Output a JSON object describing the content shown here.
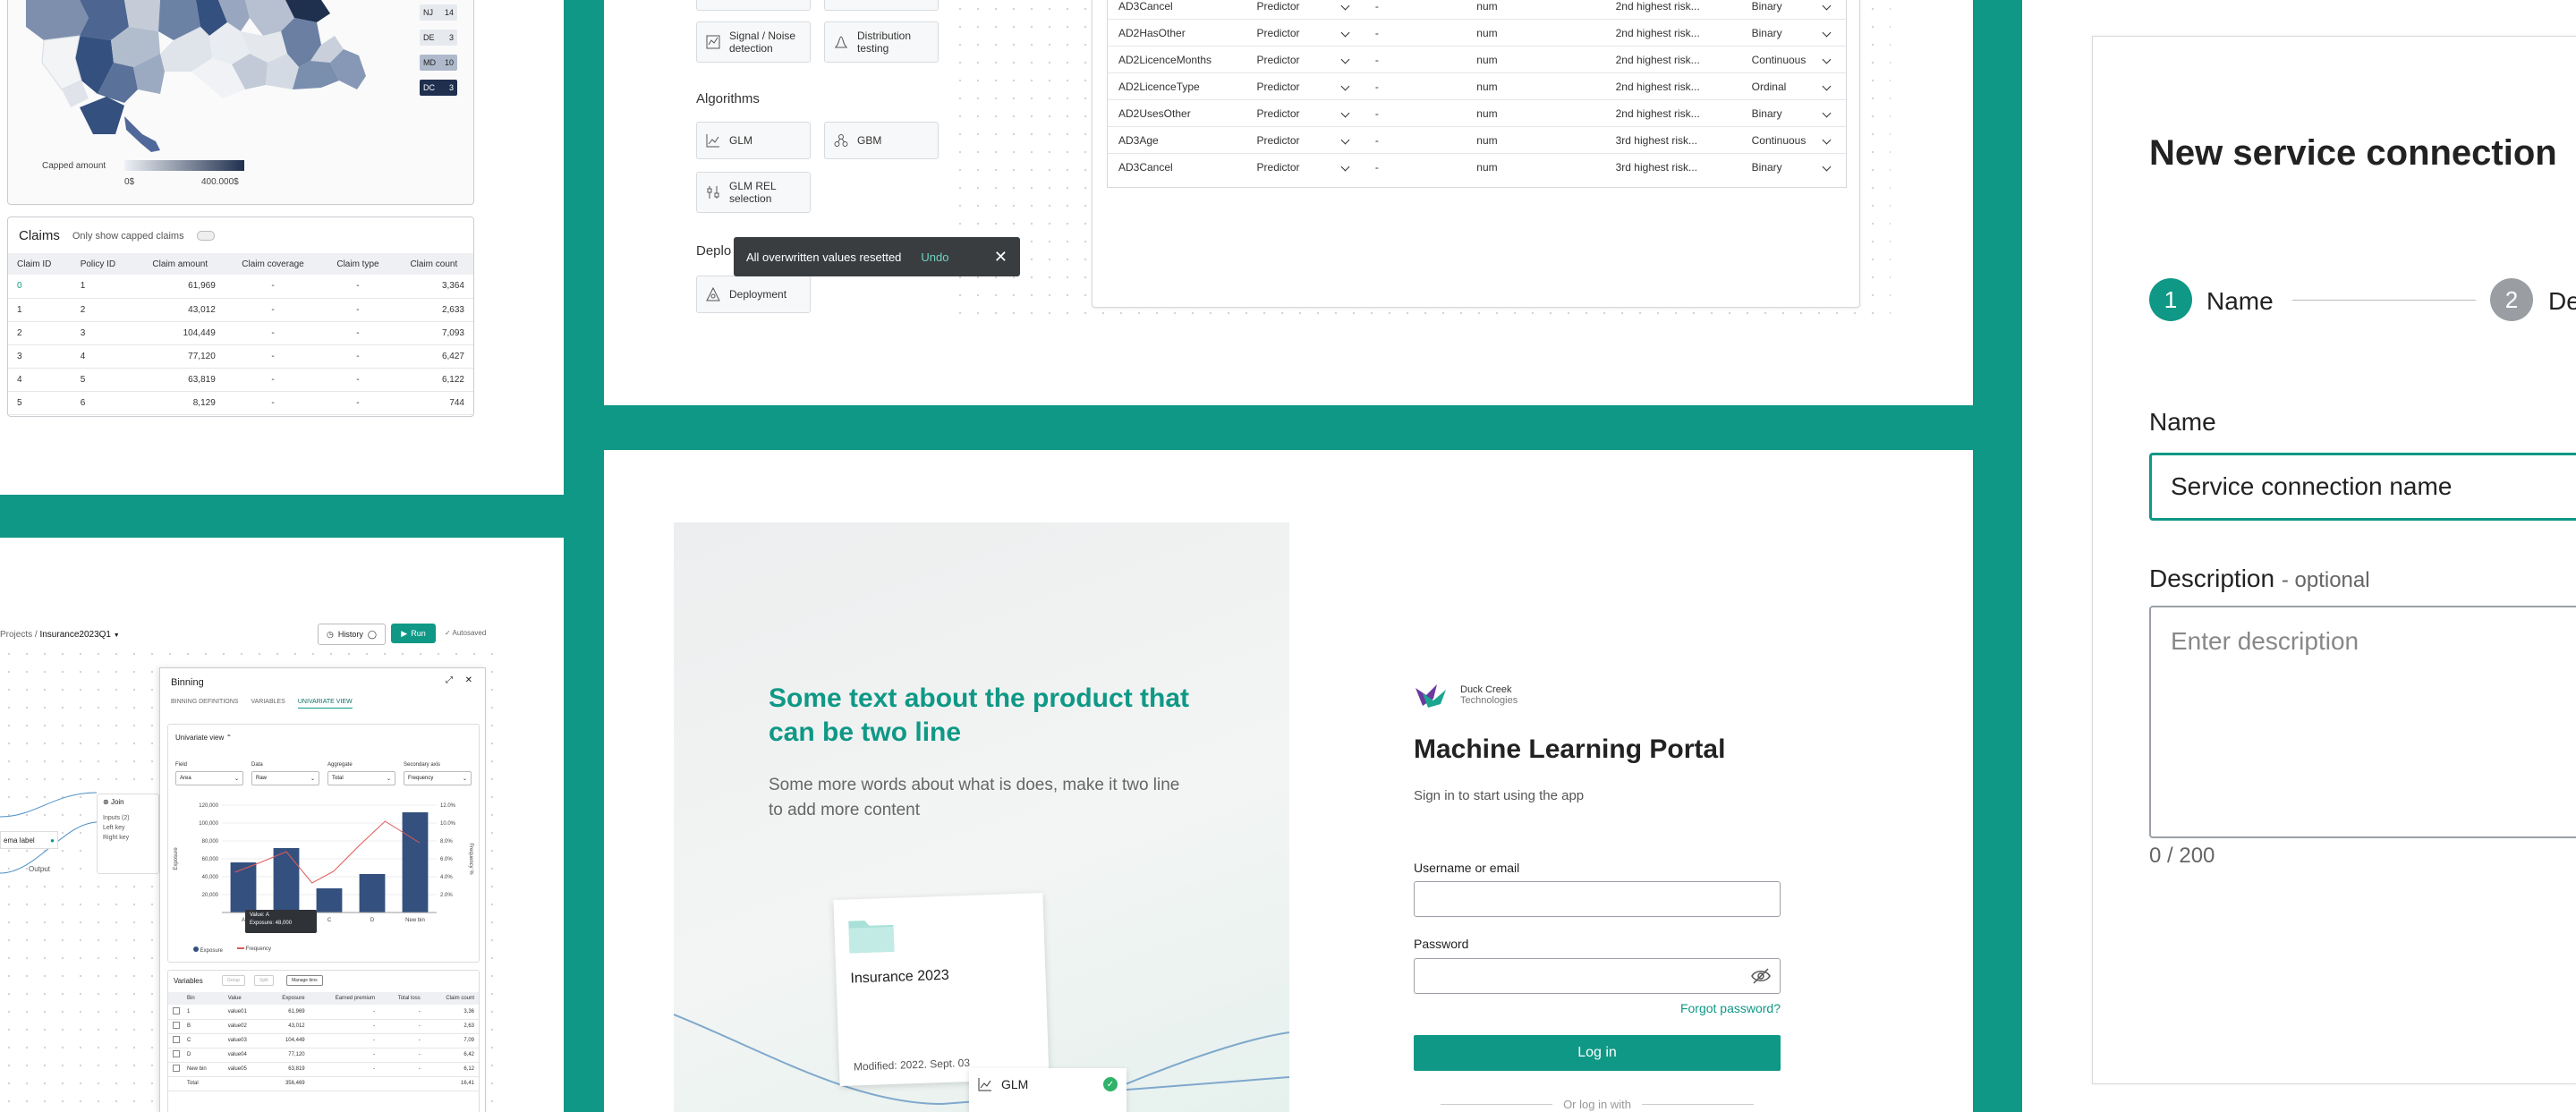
{
  "colors": {
    "accent": "#0f9886",
    "navy": "#1f2f4e",
    "map_dark": "#34507e"
  },
  "map": {
    "states": [
      {
        "code": "NJ",
        "value": "14"
      },
      {
        "code": "DE",
        "value": "3"
      },
      {
        "code": "MD",
        "value": "10"
      },
      {
        "code": "DC",
        "value": "3"
      }
    ],
    "legend_label": "Capped amount",
    "legend_min": "0$",
    "legend_max": "400.000$"
  },
  "claims": {
    "title": "Claims",
    "toggle_label": "Only show capped claims",
    "columns": [
      "Claim ID",
      "Policy ID",
      "Claim amount",
      "Claim coverage",
      "Claim type",
      "Claim count"
    ],
    "rows": [
      [
        "0",
        "1",
        "61,969",
        "-",
        "-",
        "3,364"
      ],
      [
        "1",
        "2",
        "43,012",
        "-",
        "-",
        "2,633"
      ],
      [
        "2",
        "3",
        "104,449",
        "-",
        "-",
        "7,093"
      ],
      [
        "3",
        "4",
        "77,120",
        "-",
        "-",
        "6,427"
      ],
      [
        "4",
        "5",
        "63,819",
        "-",
        "-",
        "6,122"
      ],
      [
        "5",
        "6",
        "8,129",
        "-",
        "-",
        "744"
      ]
    ]
  },
  "palette": {
    "tiles_top": [
      {
        "label": "Signal / Noise detection"
      },
      {
        "label": "Distribution testing"
      }
    ],
    "algorithms_title": "Algorithms",
    "algorithms": [
      {
        "label": "GLM"
      },
      {
        "label": "GBM"
      },
      {
        "label": "GLM REL selection"
      }
    ],
    "deploy_title": "Deplo",
    "deploy": [
      {
        "label": "Deployment"
      }
    ]
  },
  "toast": {
    "message": "All overwritten values resetted",
    "action": "Undo"
  },
  "variables_table": {
    "rows": [
      [
        "AD3Cancel",
        "Predictor",
        "-",
        "num",
        "2nd highest risk...",
        "Binary"
      ],
      [
        "AD2HasOther",
        "Predictor",
        "-",
        "num",
        "2nd highest risk...",
        "Binary"
      ],
      [
        "AD2LicenceMonths",
        "Predictor",
        "-",
        "num",
        "2nd highest risk...",
        "Continuous"
      ],
      [
        "AD2LicenceType",
        "Predictor",
        "-",
        "num",
        "2nd highest risk...",
        "Ordinal"
      ],
      [
        "AD2UsesOther",
        "Predictor",
        "-",
        "num",
        "2nd highest risk...",
        "Binary"
      ],
      [
        "AD3Age",
        "Predictor",
        "-",
        "num",
        "3rd highest risk...",
        "Continuous"
      ],
      [
        "AD3Cancel",
        "Predictor",
        "-",
        "num",
        "3rd highest risk...",
        "Binary"
      ]
    ]
  },
  "workflow": {
    "breadcrumb_root": "Projects /",
    "breadcrumb_current": "Insurance2023Q1",
    "history_label": "History",
    "run_label": "Run",
    "autosaved_label": "Autosaved",
    "node_join": "Join",
    "node_inputs": "Inputs (2)",
    "node_left": "Left key",
    "node_right": "Right key",
    "node_schema": "ema label",
    "node_output": "Output",
    "binning_title": "Binning",
    "tabs": [
      "BINNING DEFINITIONS",
      "VARIABLES",
      "UNIVARIATE VIEW"
    ],
    "univariate_title": "Univariate view",
    "filters": [
      {
        "label": "Field",
        "value": "Area"
      },
      {
        "label": "Data",
        "value": "Raw"
      },
      {
        "label": "Aggregate",
        "value": "Total"
      },
      {
        "label": "Secondary axis",
        "value": "Frequency"
      }
    ],
    "legend_exposure": "Exposure",
    "legend_frequency": "Frequency",
    "tooltip_title": "Value: A",
    "tooltip_value": "Exposure: 48,000",
    "variables_title": "Variables",
    "var_buttons": [
      "Group",
      "Split",
      "Manage bins"
    ],
    "var_columns": [
      "Bin",
      "Value",
      "Exposure",
      "Earned premium",
      "Total loss",
      "Claim count"
    ],
    "var_rows": [
      [
        "1",
        "value01",
        "61,969",
        "-",
        "-",
        "3,36"
      ],
      [
        "B",
        "value02",
        "43,012",
        "-",
        "-",
        "2,63"
      ],
      [
        "C",
        "value03",
        "104,449",
        "-",
        "-",
        "7,09"
      ],
      [
        "D",
        "value04",
        "77,120",
        "-",
        "-",
        "6,42"
      ],
      [
        "New bin",
        "value05",
        "63,819",
        "-",
        "-",
        "6,12"
      ],
      [
        "Total",
        "",
        "356,469",
        "",
        "",
        "16,41"
      ]
    ]
  },
  "chart_data": {
    "type": "bar",
    "categories": [
      "A",
      "B",
      "C",
      "D",
      "New bin"
    ],
    "ylim": [
      0,
      120000
    ],
    "y_ticks": [
      "120,000",
      "100,000",
      "80,000",
      "60,000",
      "40,000",
      "20,000"
    ],
    "y2_ticks": [
      "12.0%",
      "10.0%",
      "8.0%",
      "6.0%",
      "4.0%",
      "2.0%"
    ],
    "y2lim": [
      0,
      12
    ],
    "ylabel": "Exposure",
    "y2label": "Frequency %",
    "series": [
      {
        "name": "Exposure",
        "type": "bar",
        "values": [
          56000,
          72000,
          27000,
          43000,
          112000
        ]
      },
      {
        "name": "Frequency",
        "type": "line",
        "values": [
          5.5,
          6.8,
          3.2,
          10.2,
          8.0
        ]
      }
    ],
    "x_positions": [
      0.5,
      1.5,
      2.5,
      3.5,
      4.5
    ],
    "line_x": [
      0.3,
      0.9,
      1.5,
      2.1,
      2.6,
      3.2,
      3.8,
      4.6
    ],
    "line_y": [
      4.5,
      5.6,
      6.8,
      3.3,
      4.6,
      7.5,
      10.2,
      7.8
    ]
  },
  "login": {
    "headline": "Some text about the product that can be two line",
    "subline": "Some more words about what is does, make it two line to add more content",
    "card_title": "Insurance 2023",
    "card_modified": "Modified: 2022. Sept. 03",
    "card_glm": "GLM",
    "brand_line1": "Duck Creek",
    "brand_line2": "Technologies",
    "title": "Machine Learning Portal",
    "subtitle": "Sign in to start using the app",
    "username_label": "Username or email",
    "password_label": "Password",
    "forgot": "Forgot password?",
    "login_button": "Log in",
    "or_login": "Or log in with"
  },
  "service": {
    "title": "New service connection",
    "steps": [
      {
        "num": "1",
        "label": "Name"
      },
      {
        "num": "2",
        "label": "De"
      }
    ],
    "name_label": "Name",
    "name_value": "Service connection name",
    "desc_label": "Description",
    "desc_optional": "- optional",
    "desc_placeholder": "Enter description",
    "counter": "0 / 200"
  }
}
